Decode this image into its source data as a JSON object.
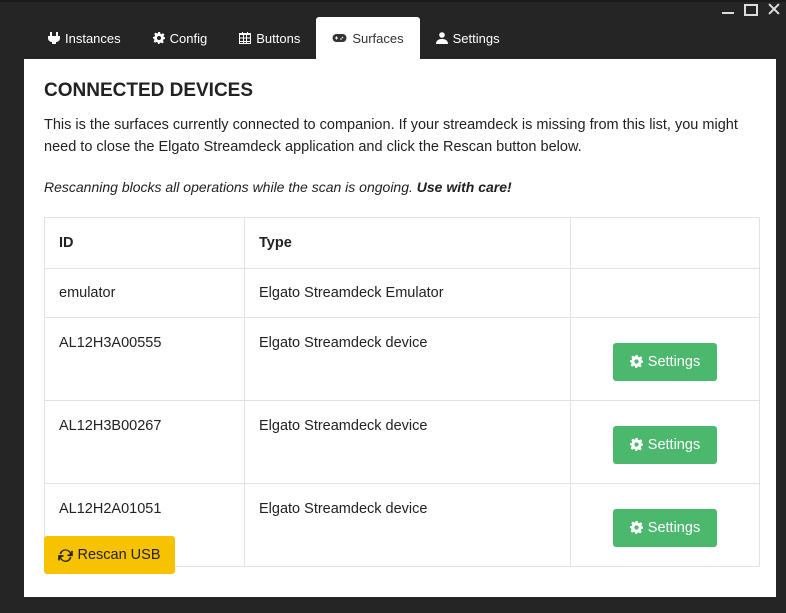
{
  "tabs": [
    {
      "label": "Instances",
      "icon": "plug-icon"
    },
    {
      "label": "Config",
      "icon": "gear-icon"
    },
    {
      "label": "Buttons",
      "icon": "grid-icon"
    },
    {
      "label": "Surfaces",
      "icon": "gamepad-icon",
      "active": true
    },
    {
      "label": "Settings",
      "icon": "user-cog-icon"
    }
  ],
  "panel": {
    "title": "CONNECTED DEVICES",
    "description": "This is the surfaces currently connected to companion. If your streamdeck is missing from this list, you might need to close the Elgato Streamdeck application and click the Rescan button below.",
    "warning_text": "Rescanning blocks all operations while the scan is ongoing. ",
    "warning_bold": "Use with care!"
  },
  "table": {
    "headers": [
      "ID",
      "Type",
      ""
    ],
    "rows": [
      {
        "id": "emulator",
        "type": "Elgato Streamdeck Emulator",
        "action": ""
      },
      {
        "id": "AL12H3A00555",
        "type": "Elgato Streamdeck device",
        "action": "Settings"
      },
      {
        "id": "AL12H3B00267",
        "type": "Elgato Streamdeck device",
        "action": "Settings"
      },
      {
        "id": "AL12H2A01051",
        "type": "Elgato Streamdeck device",
        "action": "Settings"
      }
    ]
  },
  "rescan_label": "Rescan USB",
  "colors": {
    "background": "#252525",
    "settings_button": "#4cb86e",
    "rescan_button": "#f7c300"
  }
}
